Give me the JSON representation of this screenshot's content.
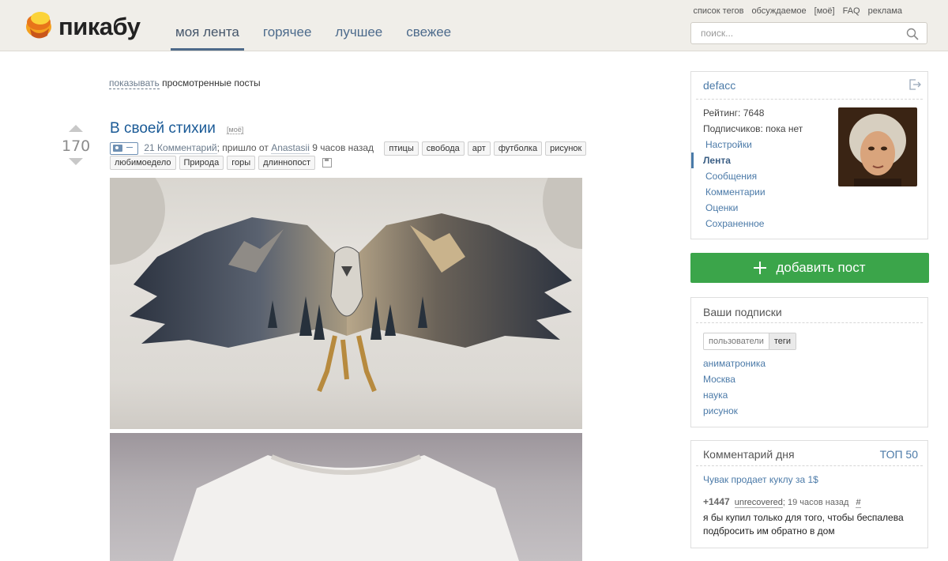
{
  "header": {
    "logo_text": "пикабу",
    "nav": [
      "моя лента",
      "горячее",
      "лучшее",
      "свежее"
    ],
    "nav_active": "моя лента",
    "toplinks": [
      "список тегов",
      "обсуждаемое",
      "[моё]",
      "FAQ",
      "реклама"
    ],
    "search_placeholder": "поиск..."
  },
  "viewed": {
    "show_label": "показывать",
    "rest": "просмотренные посты"
  },
  "post": {
    "rating": "170",
    "title": "В своей стихии",
    "mine_label": "[моё]",
    "comments_label": "21 Комментарий",
    "came_from": "; пришло от",
    "author": "Anastasii",
    "time": "9 часов назад",
    "tags": [
      "птицы",
      "свобода",
      "арт",
      "футболка",
      "рисунок"
    ],
    "tags2": [
      "любимоедело",
      "Природа",
      "горы",
      "длиннопост"
    ]
  },
  "sidebar": {
    "username": "defacc",
    "rating_label": "Рейтинг: 7648",
    "subscribers_label": "Подписчиков: пока нет",
    "menu": [
      "Настройки",
      "Лента",
      "Сообщения",
      "Комментарии",
      "Оценки",
      "Сохраненное"
    ],
    "menu_active": "Лента",
    "add_post_label": "добавить пост",
    "subscriptions_title": "Ваши подписки",
    "toggle_users": "пользователи",
    "toggle_tags": "теги",
    "subscriptions": [
      "аниматроника",
      "Москва",
      "наука",
      "рисунок"
    ],
    "comment_day_title": "Комментарий дня",
    "comment_top": "ТОП 50",
    "comment_post_link": "Чувак продает куклу за 1$",
    "comment_score": "+1447",
    "comment_user": "unrecovered",
    "comment_time": "; 19 часов назад",
    "comment_hash": "#",
    "comment_text": "я бы купил только для того, чтобы беспалева подбросить им обратно в дом"
  },
  "colors": {
    "link": "#4b7aa8",
    "title": "#1a5a96",
    "add_post": "#3ba54a",
    "header_bg": "#f0eee9"
  }
}
